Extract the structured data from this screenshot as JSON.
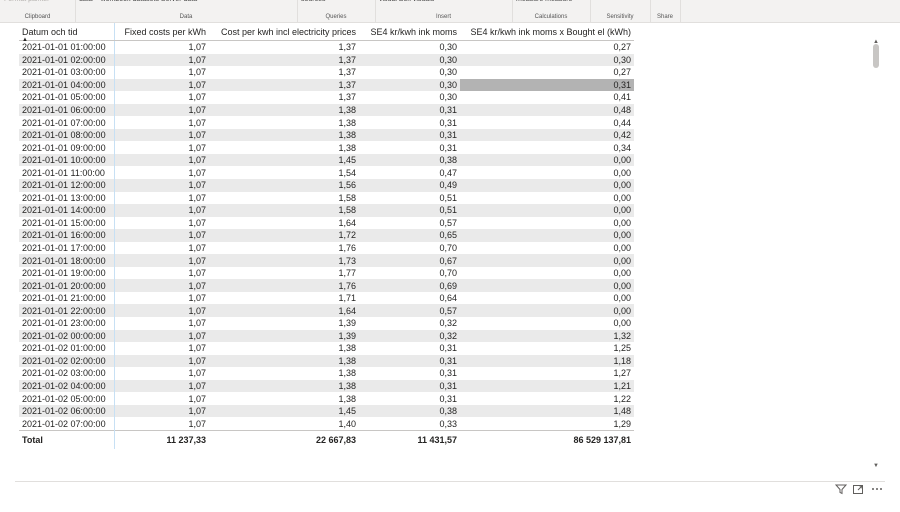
{
  "ribbon": {
    "groups": [
      {
        "top": "Format painter",
        "top_dim": true,
        "label": "Clipboard"
      },
      {
        "top": "data ˅  workbook  datasets  Server   data",
        "top_dim": false,
        "label": "Data"
      },
      {
        "top": "sources ˅",
        "top_dim": false,
        "label": "Queries"
      },
      {
        "top": "visual       Box   visuals ˅",
        "top_dim": false,
        "label": "Insert"
      },
      {
        "top": "measure measure",
        "top_dim": false,
        "label": "Calculations"
      },
      {
        "top": "˅",
        "top_dim": true,
        "label": "Sensitivity"
      },
      {
        "top": "",
        "top_dim": false,
        "label": "Share"
      }
    ]
  },
  "table": {
    "columns": [
      "Datum och tid",
      "Fixed costs per kWh",
      "Cost per kwh incl electricity prices",
      "SE4 kr/kwh ink moms",
      "SE4 kr/kwh ink moms x Bought el (kWh)"
    ],
    "rows": [
      [
        "2021-01-01 01:00:00",
        "1,07",
        "1,37",
        "0,30",
        "0,27"
      ],
      [
        "2021-01-01 02:00:00",
        "1,07",
        "1,37",
        "0,30",
        "0,30"
      ],
      [
        "2021-01-01 03:00:00",
        "1,07",
        "1,37",
        "0,30",
        "0,27"
      ],
      [
        "2021-01-01 04:00:00",
        "1,07",
        "1,37",
        "0,30",
        "0,31"
      ],
      [
        "2021-01-01 05:00:00",
        "1,07",
        "1,37",
        "0,30",
        "0,41"
      ],
      [
        "2021-01-01 06:00:00",
        "1,07",
        "1,38",
        "0,31",
        "0,48"
      ],
      [
        "2021-01-01 07:00:00",
        "1,07",
        "1,38",
        "0,31",
        "0,44"
      ],
      [
        "2021-01-01 08:00:00",
        "1,07",
        "1,38",
        "0,31",
        "0,42"
      ],
      [
        "2021-01-01 09:00:00",
        "1,07",
        "1,38",
        "0,31",
        "0,34"
      ],
      [
        "2021-01-01 10:00:00",
        "1,07",
        "1,45",
        "0,38",
        "0,00"
      ],
      [
        "2021-01-01 11:00:00",
        "1,07",
        "1,54",
        "0,47",
        "0,00"
      ],
      [
        "2021-01-01 12:00:00",
        "1,07",
        "1,56",
        "0,49",
        "0,00"
      ],
      [
        "2021-01-01 13:00:00",
        "1,07",
        "1,58",
        "0,51",
        "0,00"
      ],
      [
        "2021-01-01 14:00:00",
        "1,07",
        "1,58",
        "0,51",
        "0,00"
      ],
      [
        "2021-01-01 15:00:00",
        "1,07",
        "1,64",
        "0,57",
        "0,00"
      ],
      [
        "2021-01-01 16:00:00",
        "1,07",
        "1,72",
        "0,65",
        "0,00"
      ],
      [
        "2021-01-01 17:00:00",
        "1,07",
        "1,76",
        "0,70",
        "0,00"
      ],
      [
        "2021-01-01 18:00:00",
        "1,07",
        "1,73",
        "0,67",
        "0,00"
      ],
      [
        "2021-01-01 19:00:00",
        "1,07",
        "1,77",
        "0,70",
        "0,00"
      ],
      [
        "2021-01-01 20:00:00",
        "1,07",
        "1,76",
        "0,69",
        "0,00"
      ],
      [
        "2021-01-01 21:00:00",
        "1,07",
        "1,71",
        "0,64",
        "0,00"
      ],
      [
        "2021-01-01 22:00:00",
        "1,07",
        "1,64",
        "0,57",
        "0,00"
      ],
      [
        "2021-01-01 23:00:00",
        "1,07",
        "1,39",
        "0,32",
        "0,00"
      ],
      [
        "2021-01-02 00:00:00",
        "1,07",
        "1,39",
        "0,32",
        "1,32"
      ],
      [
        "2021-01-02 01:00:00",
        "1,07",
        "1,38",
        "0,31",
        "1,25"
      ],
      [
        "2021-01-02 02:00:00",
        "1,07",
        "1,38",
        "0,31",
        "1,18"
      ],
      [
        "2021-01-02 03:00:00",
        "1,07",
        "1,38",
        "0,31",
        "1,27"
      ],
      [
        "2021-01-02 04:00:00",
        "1,07",
        "1,38",
        "0,31",
        "1,21"
      ],
      [
        "2021-01-02 05:00:00",
        "1,07",
        "1,38",
        "0,31",
        "1,22"
      ],
      [
        "2021-01-02 06:00:00",
        "1,07",
        "1,45",
        "0,38",
        "1,48"
      ],
      [
        "2021-01-02 07:00:00",
        "1,07",
        "1,40",
        "0,33",
        "1,29"
      ]
    ],
    "total": [
      "Total",
      "11 237,33",
      "22 667,83",
      "11 431,57",
      "86 529 137,81"
    ],
    "highlighted_cell": {
      "row": 3,
      "col": 4
    }
  },
  "visual_header_icons": [
    "filter-icon",
    "focus-mode-icon",
    "more-options-icon"
  ],
  "colors": {
    "highlight": "#b3b3b3",
    "row_shade": "#eaeaea",
    "column_divider": "#c7e0f4"
  }
}
